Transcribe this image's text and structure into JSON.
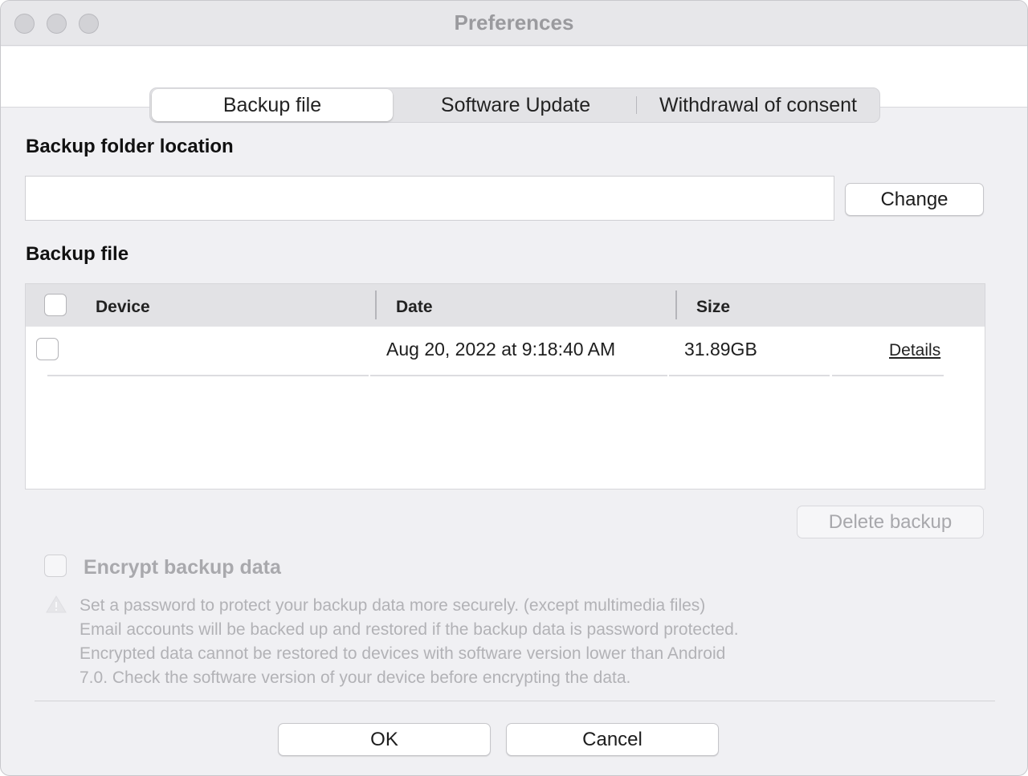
{
  "window": {
    "title": "Preferences"
  },
  "tabs": [
    {
      "label": "Backup file",
      "active": true
    },
    {
      "label": "Software Update",
      "active": false
    },
    {
      "label": "Withdrawal of consent",
      "active": false
    }
  ],
  "folder": {
    "section_label": "Backup folder location",
    "path_value": "",
    "change_label": "Change"
  },
  "backup": {
    "section_label": "Backup file",
    "columns": [
      "Device",
      "Date",
      "Size"
    ],
    "rows": [
      {
        "device": "",
        "date": "Aug 20, 2022 at 9:18:40 AM",
        "size": "31.89GB",
        "details": "Details",
        "checked": false
      }
    ],
    "delete_label": "Delete backup"
  },
  "encrypt": {
    "label": "Encrypt backup data",
    "checked": false,
    "enabled": false,
    "warning_lines": [
      "Set a password to protect your backup data more securely. (except multimedia files)",
      "Email accounts will be backed up and restored if the backup data is password protected.",
      "Encrypted data cannot be restored to devices with software version lower than Android",
      "7.0. Check the software version of your device before encrypting the data."
    ]
  },
  "footer": {
    "ok_label": "OK",
    "cancel_label": "Cancel"
  }
}
